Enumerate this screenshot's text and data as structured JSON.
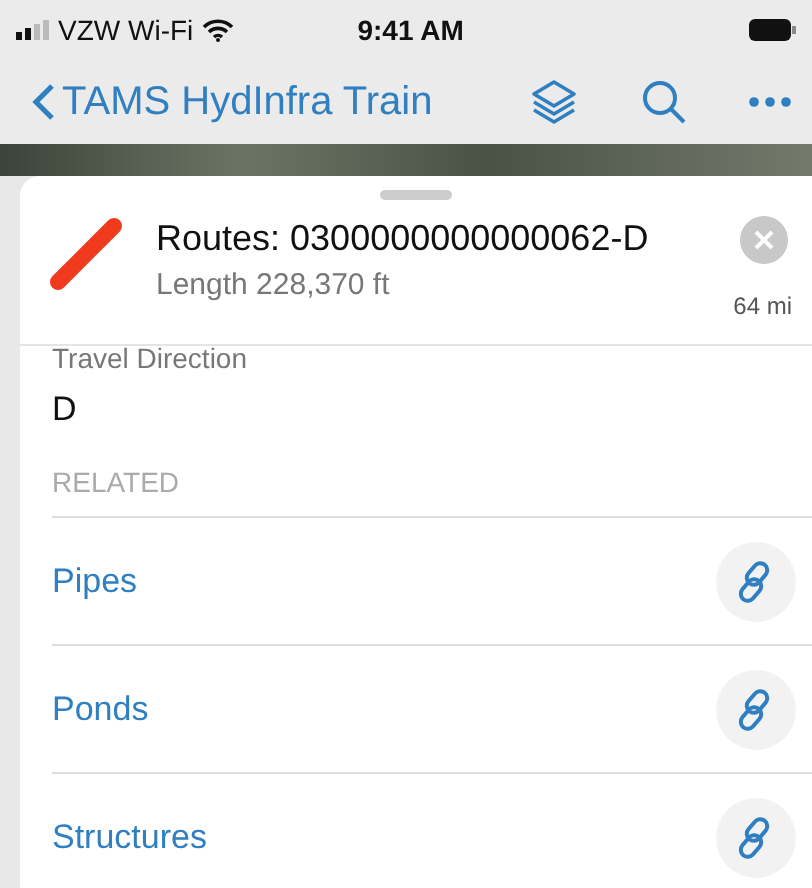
{
  "status_bar": {
    "carrier": "VZW Wi-Fi",
    "time": "9:41 AM"
  },
  "nav_bar": {
    "back_label": "TAMS HydInfra Train"
  },
  "feature": {
    "title": "Routes: 0300000000000062-D",
    "subtitle": "Length 228,370 ft",
    "distance": "64 mi",
    "color": "#f03a1e"
  },
  "attribute": {
    "label": "Travel Direction",
    "value": "D"
  },
  "related": {
    "heading": "RELATED",
    "items": [
      {
        "label": "Pipes"
      },
      {
        "label": "Ponds"
      },
      {
        "label": "Structures"
      }
    ]
  }
}
